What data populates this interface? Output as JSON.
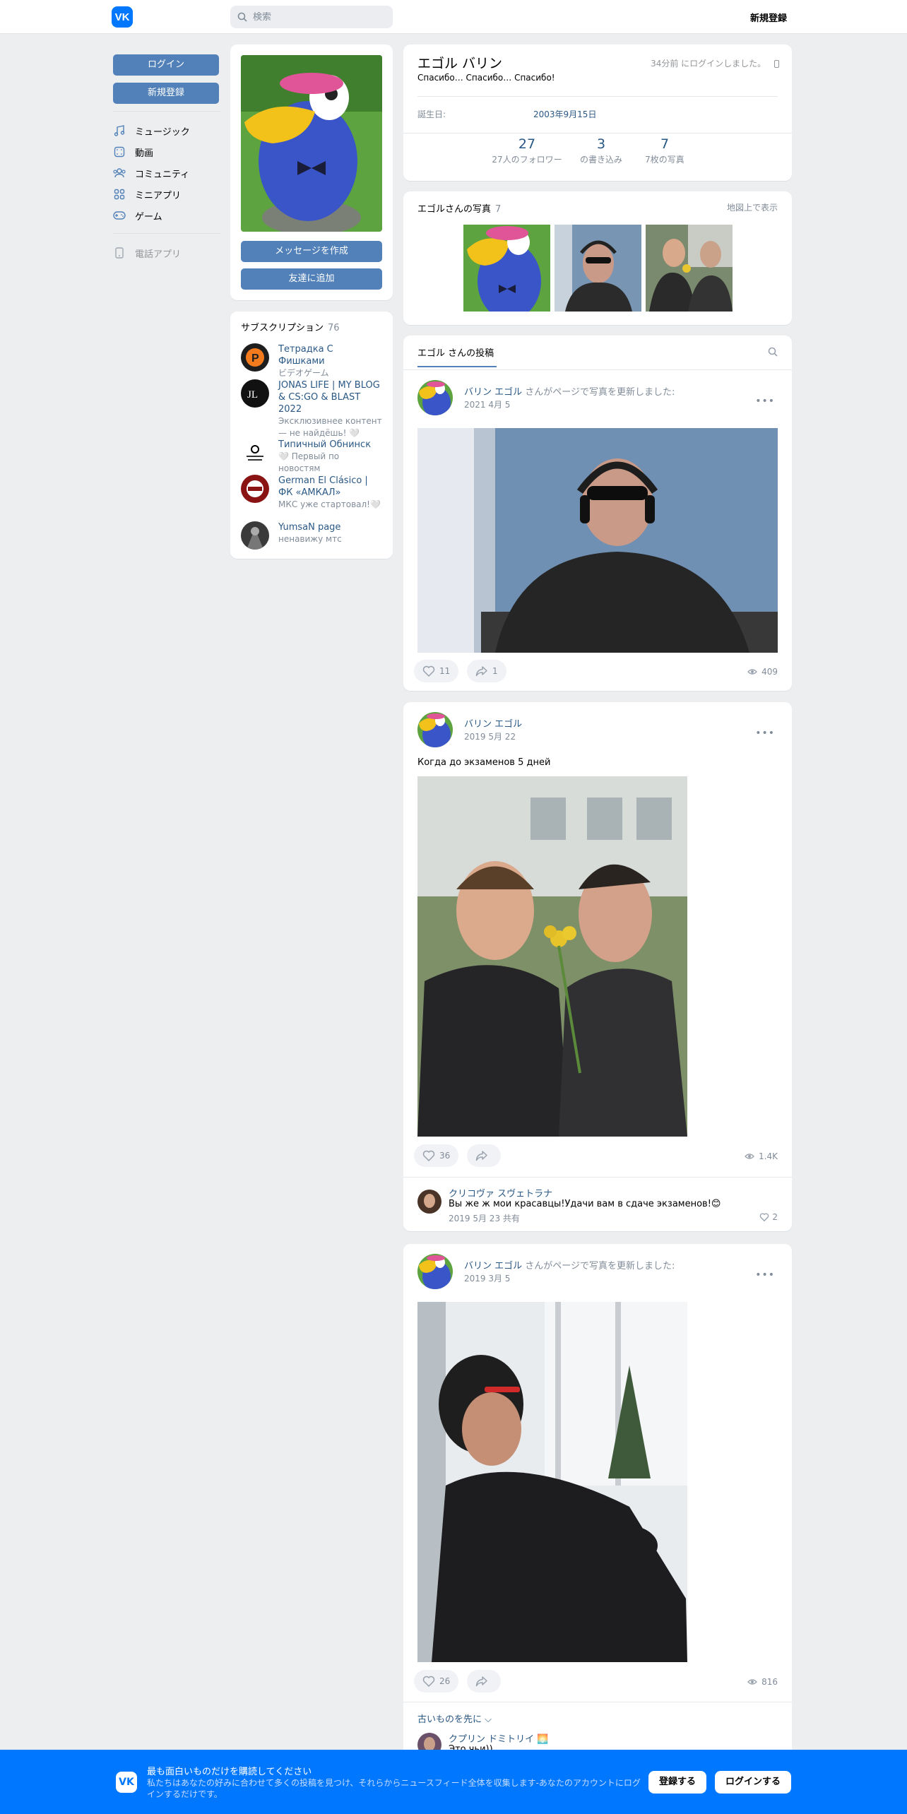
{
  "header": {
    "logo": "VK",
    "search_placeholder": "検索",
    "signup": "新規登録"
  },
  "leftnav": {
    "login": "ログイン",
    "register": "新規登録",
    "items": [
      {
        "label": "ミュージック",
        "icon": "music-icon"
      },
      {
        "label": "動画",
        "icon": "video-icon"
      },
      {
        "label": "コミュニティ",
        "icon": "community-icon"
      },
      {
        "label": "ミニアプリ",
        "icon": "apps-icon"
      },
      {
        "label": "ゲーム",
        "icon": "game-icon"
      }
    ],
    "phone_app": "電話アプリ"
  },
  "profile_card": {
    "message_button": "メッセージを作成",
    "add_friend_button": "友達に追加"
  },
  "subscriptions": {
    "title": "サブスクリプション",
    "count": "76",
    "items": [
      {
        "name": "Тетрадка С Фишками",
        "desc": "ビデオゲーム"
      },
      {
        "name": "JONAS LIFE | MY BLOG & CS:GO & BLAST 2022",
        "desc": "Эксклюзивнее контент — не найдёшь! 🤍"
      },
      {
        "name": "Типичный Обнинск",
        "desc": "🤍 Первый по новостям"
      },
      {
        "name": "German El Clásico | ФК «АМКАЛ»",
        "desc": "МКС уже стартовал!🤍"
      },
      {
        "name": "YumsaN page",
        "desc": "ненавижу мтс"
      }
    ]
  },
  "profile": {
    "name": "エゴル バリン",
    "status": "Спасибо… Спасибо… Спасибо!",
    "online": "34分前 にログインしました。",
    "birthday_label": "誕生日:",
    "birthday": "2003年9月15日",
    "counters": [
      {
        "n": "27",
        "t": "27人のフォロワー"
      },
      {
        "n": "3",
        "t": "の書き込み"
      },
      {
        "n": "7",
        "t": "7枚の写真"
      }
    ]
  },
  "photos": {
    "title": "エゴルさんの写真",
    "count": "7",
    "map": "地図上で表示"
  },
  "wall": {
    "tab": "エゴル さんの投稿"
  },
  "posts": [
    {
      "author": "バリン エゴル",
      "action": "さんがページで写真を更新しました:",
      "date": "2021 4月 5",
      "likes": "11",
      "shares": "1",
      "views": "409",
      "text": ""
    },
    {
      "author": "バリン エゴル",
      "action": "",
      "date": "2019 5月 22",
      "likes": "36",
      "shares": "",
      "views": "1.4K",
      "text": "Когда до экзаменов 5 дней",
      "comment": {
        "name": "クリコヴァ スヴェトラナ",
        "text": "Вы же ж мои красавцы!Удачи вам в сдаче экзаменов!😊",
        "meta": "2019 5月 23  共有",
        "likes": "2"
      }
    },
    {
      "author": "バリン エゴル",
      "action": "さんがページで写真を更新しました:",
      "date": "2019 3月 5",
      "likes": "26",
      "shares": "",
      "views": "816",
      "text": "",
      "older": "古いものを先に ⌵",
      "comment": {
        "name": "クプリン ドミトリイ 🌅",
        "text": "Это чьи))"
      }
    }
  ],
  "banner": {
    "title": "最も面白いものだけを購読してください",
    "desc": "私たちはあなたの好みに合わせて多くの投稿を見つけ、それらからニュースフィード全体を収集します-あなたのアカウントにログインするだけです。",
    "subscribe": "登録する",
    "login": "ログインする"
  }
}
